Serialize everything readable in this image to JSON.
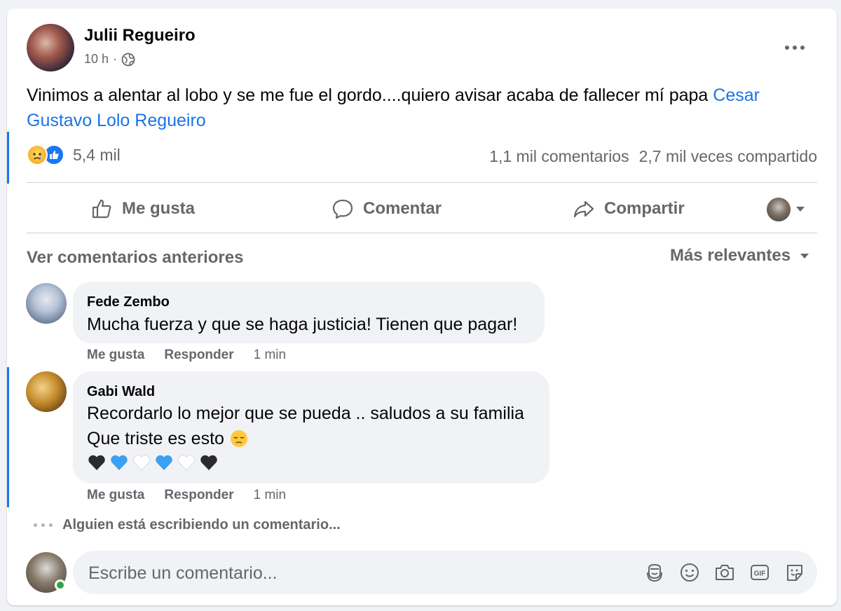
{
  "post": {
    "author": "Julii Regueiro",
    "time": "10 h",
    "separator": "·",
    "privacy_icon": "globe-icon",
    "text_main": "Vinimos a alentar al lobo y se me fue el gordo....quiero avisar acaba de fallecer mí papa ",
    "text_tag": "Cesar Gustavo Lolo Regueiro",
    "reactions": {
      "icons": [
        "sad-reaction-icon",
        "like-reaction-icon"
      ],
      "count": "5,4 mil"
    },
    "comments_count": "1,1 mil comentarios",
    "shares_count": "2,7 mil veces compartido"
  },
  "actions": {
    "like": "Me gusta",
    "comment": "Comentar",
    "share": "Compartir"
  },
  "comments_header": {
    "previous": "Ver comentarios anteriores",
    "sort": "Más relevantes"
  },
  "comments": [
    {
      "author": "Fede Zembo",
      "text": "Mucha fuerza y que se haga justicia! Tienen que pagar!",
      "like": "Me gusta",
      "reply": "Responder",
      "time": "1 min"
    },
    {
      "author": "Gabi Wald",
      "text_line1": "Recordarlo lo mejor que se pueda .. saludos a su familia",
      "text_line2": "Que triste es esto",
      "emoji": "pensive-face-emoji",
      "hearts": [
        "black-heart",
        "blue-heart",
        "white-heart",
        "blue-heart",
        "white-heart",
        "black-heart"
      ],
      "like": "Me gusta",
      "reply": "Responder",
      "time": "1 min"
    }
  ],
  "typing": "Alguien está escribiendo un comentario...",
  "composer": {
    "placeholder": "Escribe un comentario...",
    "icons": [
      "avatar-sticker-icon",
      "emoji-icon",
      "camera-icon",
      "gif-icon",
      "sticker-icon"
    ]
  },
  "colors": {
    "link": "#1b74e4",
    "accent": "#1877f2",
    "muted": "#65676b",
    "bubble": "#f0f2f5",
    "online": "#31a24c"
  }
}
